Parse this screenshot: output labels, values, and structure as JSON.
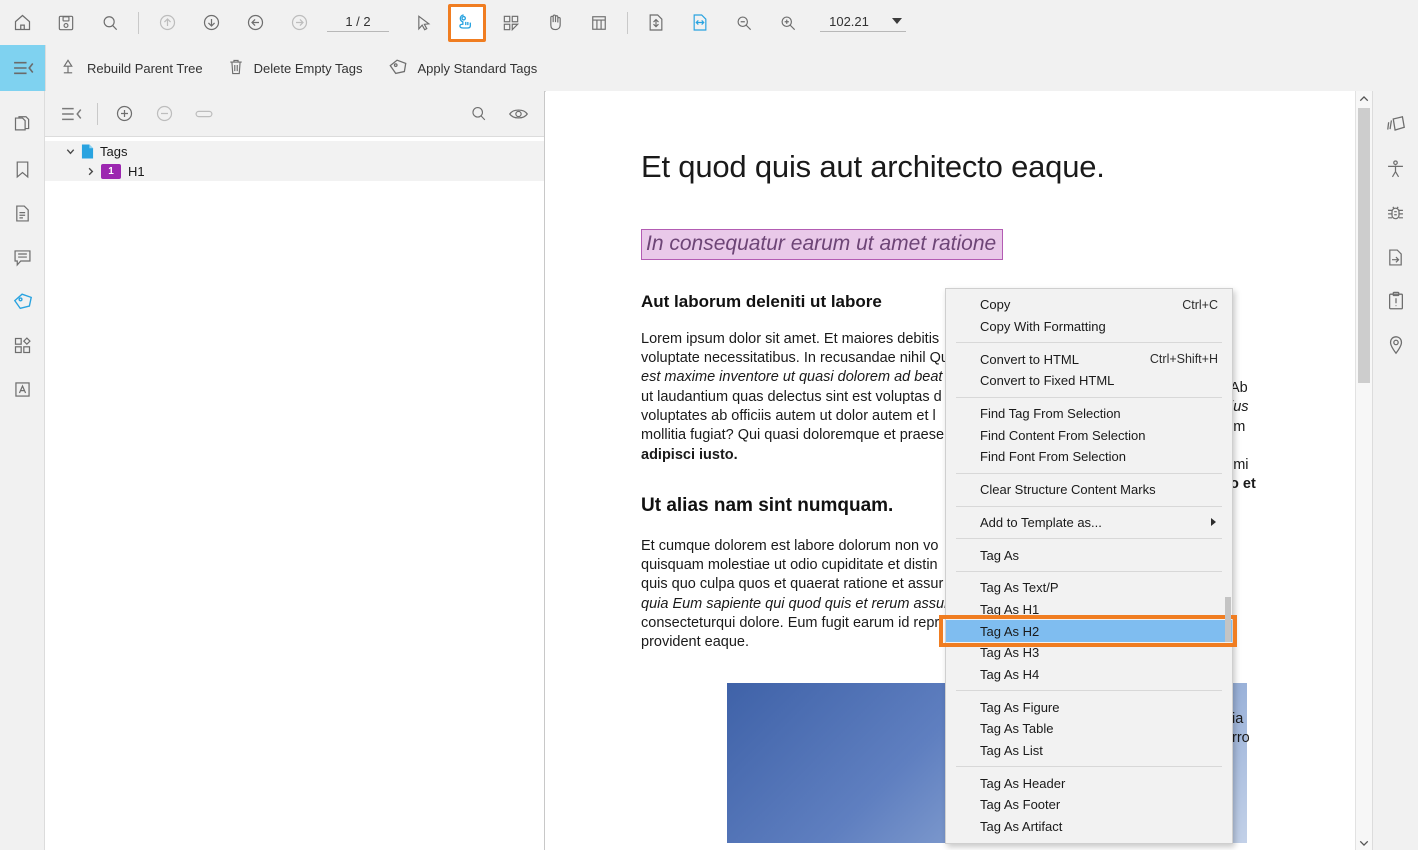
{
  "toolbar": {
    "icons": [
      {
        "name": "home-icon",
        "label": "Home"
      },
      {
        "name": "save-icon",
        "label": "Save"
      },
      {
        "name": "search-icon",
        "label": "Search"
      },
      {
        "name": "first-page-icon",
        "label": "First Page"
      },
      {
        "name": "next-page-icon",
        "label": "Next Page"
      },
      {
        "name": "previous-page-icon",
        "label": "Previous Page"
      },
      {
        "name": "last-page-icon",
        "label": "Last Page"
      }
    ],
    "page_value": "1 / 2",
    "select-tool": "Select Tool",
    "tag-tool": "Tag Tool",
    "grid-tool": "Grid Tool",
    "hand-tool": "Hand Tool",
    "table-tool": "Table Tool",
    "fit-page": "Fit Page",
    "fit-width": "Fit Width",
    "zoom-out": "Zoom Out",
    "zoom-in": "Zoom In",
    "zoom_value": "102.21"
  },
  "tag_toolbar": {
    "items": [
      {
        "label": "Rebuild Parent Tree",
        "icon": "rebuild-parent-tree-icon"
      },
      {
        "label": "Delete Empty Tags",
        "icon": "trash-icon"
      },
      {
        "label": "Apply Standard Tags",
        "icon": "tag-icon"
      }
    ]
  },
  "tags_panel": {
    "collapse_label": "Collapse",
    "add_label": "Add Tag",
    "remove_label": "Remove Tag",
    "link_label": "Link",
    "search_label": "Search",
    "visibility_label": "Toggle Visibility",
    "tree": [
      {
        "label": "Tags",
        "level": 0,
        "expanded": true,
        "badge": null
      },
      {
        "label": "H1",
        "level": 1,
        "expanded": false,
        "badge": "1"
      }
    ]
  },
  "left_rail": {
    "items": [
      {
        "name": "pages-icon",
        "label": "Pages"
      },
      {
        "name": "bookmarks-icon",
        "label": "Bookmarks"
      },
      {
        "name": "document-icon",
        "label": "Document"
      },
      {
        "name": "comments-icon",
        "label": "Comments"
      },
      {
        "name": "tags-icon",
        "label": "Tags",
        "active": true
      },
      {
        "name": "content-icon",
        "label": "Content"
      },
      {
        "name": "fonts-icon",
        "label": "Fonts"
      }
    ]
  },
  "right_rail": {
    "items": [
      {
        "name": "pages-stack-icon",
        "label": "Page Thumbnails"
      },
      {
        "name": "accessibility-icon",
        "label": "Accessibility"
      },
      {
        "name": "debug-icon",
        "label": "Debug"
      },
      {
        "name": "export-icon",
        "label": "Export"
      },
      {
        "name": "report-icon",
        "label": "Report"
      },
      {
        "name": "location-icon",
        "label": "Location"
      }
    ]
  },
  "document": {
    "heading1": "Et quod quis aut architecto eaque.",
    "subtitle": "In consequatur earum ut amet ratione",
    "heading2_a": "Aut laborum deleniti ut labore",
    "para1_parts": [
      {
        "text": "Lorem ipsum dolor sit amet. Et maiores debitis ",
        "style": "normal"
      },
      {
        "text": "Ab",
        "style": "normal"
      },
      {
        "text": "voluptate necessitatibus. In recusandae nihil ",
        "style": "normal"
      },
      {
        "text": "Qu",
        "style": "italic"
      },
      {
        "text": "ius",
        "style": "italic"
      },
      {
        "text": "est maxime inventore",
        "style": "italic"
      },
      {
        "text": " ut quasi dolorem ad beat",
        "style": "normal"
      },
      {
        "text": "im",
        "style": "normal"
      },
      {
        "text": "ut laudantium quas delectus sint est voluptas d",
        "style": "normal"
      },
      {
        "text": "voluptates ab officiis autem ut dolor autem et l",
        "style": "normal"
      },
      {
        "text": "imi",
        "style": "normal"
      },
      {
        "text": "mollitia fugiat? Qui quasi doloremque et praese",
        "style": "normal"
      },
      {
        "text": "o et",
        "style": "bold"
      },
      {
        "text": "adipisci iusto.",
        "style": "bold"
      }
    ],
    "para1_lines": [
      "Lorem ipsum dolor sit amet. Et maiores debitis",
      "voluptate necessitatibus. In recusandae nihil Qu",
      "est maxime inventore ut quasi dolorem ad beat",
      "ut laudantium quas delectus sint est voluptas d",
      "voluptates ab officiis autem ut dolor autem et l",
      "mollitia fugiat? Qui quasi doloremque et praese",
      "adipisci iusto."
    ],
    "right_fragments": [
      "Ab",
      "ius",
      "im",
      "imi",
      "o et"
    ],
    "heading2_b": "Ut alias nam sint numquam.",
    "para2_lines": [
      "Et cumque dolorem est labore dolorum non vo",
      "quisquam molestiae ut odio cupiditate et distin",
      "quis quo culpa quos et quaerat ratione et assur",
      "quia Eum sapiente qui quod quis et rerum assur",
      "consecteturqui dolore. Eum fugit earum id repr",
      "provident eaque."
    ],
    "right_fragments2": [
      "ia",
      "rro"
    ],
    "figure_label": "Blue gradient image"
  },
  "context_menu": {
    "groups": [
      {
        "items": [
          {
            "label": "Copy",
            "shortcut": "Ctrl+C"
          },
          {
            "label": "Copy With Formatting",
            "shortcut": ""
          }
        ]
      },
      {
        "items": [
          {
            "label": "Convert to HTML",
            "shortcut": "Ctrl+Shift+H"
          },
          {
            "label": "Convert to Fixed HTML",
            "shortcut": ""
          }
        ]
      },
      {
        "items": [
          {
            "label": "Find Tag From Selection",
            "shortcut": ""
          },
          {
            "label": "Find Content From Selection",
            "shortcut": ""
          },
          {
            "label": "Find Font From Selection",
            "shortcut": ""
          }
        ]
      },
      {
        "items": [
          {
            "label": "Clear Structure Content Marks",
            "shortcut": ""
          }
        ]
      },
      {
        "items": [
          {
            "label": "Add to Template as...",
            "shortcut": "",
            "submenu": true
          }
        ]
      },
      {
        "items": [
          {
            "label": "Tag As",
            "shortcut": ""
          }
        ]
      },
      {
        "items": [
          {
            "label": "Tag As Text/P",
            "shortcut": ""
          },
          {
            "label": "Tag As H1",
            "shortcut": ""
          },
          {
            "label": "Tag As H2",
            "shortcut": "",
            "selected": true
          },
          {
            "label": "Tag As H3",
            "shortcut": ""
          },
          {
            "label": "Tag As H4",
            "shortcut": ""
          }
        ]
      },
      {
        "items": [
          {
            "label": "Tag As Figure",
            "shortcut": ""
          },
          {
            "label": "Tag As Table",
            "shortcut": ""
          },
          {
            "label": "Tag As List",
            "shortcut": ""
          }
        ]
      },
      {
        "items": [
          {
            "label": "Tag As Header",
            "shortcut": ""
          },
          {
            "label": "Tag As Footer",
            "shortcut": ""
          },
          {
            "label": "Tag As Artifact",
            "shortcut": ""
          }
        ]
      }
    ]
  },
  "colors": {
    "accent_orange": "#f07d21",
    "selection_blue": "#7fbdf0",
    "tag_purple": "#9c27b0",
    "highlight_purple_bg": "#e9c9e9",
    "active_icon_blue": "#29a3e0"
  }
}
